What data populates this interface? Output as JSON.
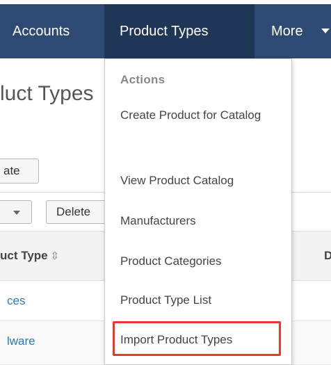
{
  "nav": {
    "accounts": "Accounts",
    "product_types": "Product Types",
    "more": "More",
    "active_color": "#1f3656",
    "bar_color": "#2c4a73",
    "caret_icon": "caret-down"
  },
  "page": {
    "title_fragment": "luct Types",
    "create_label": "ate",
    "delete_label": "Delete",
    "column_header": "uct Type",
    "column_header_d": "D",
    "sort_icon": "⇳",
    "rows": [
      "ces",
      "lware"
    ]
  },
  "dropdown": {
    "heading": "Actions",
    "items": [
      "Create Product for Catalog",
      "View Product Catalog",
      "Manufacturers",
      "Product Categories",
      "Product Type List",
      "Import Product Types"
    ],
    "highlight_color": "#e8392c"
  }
}
